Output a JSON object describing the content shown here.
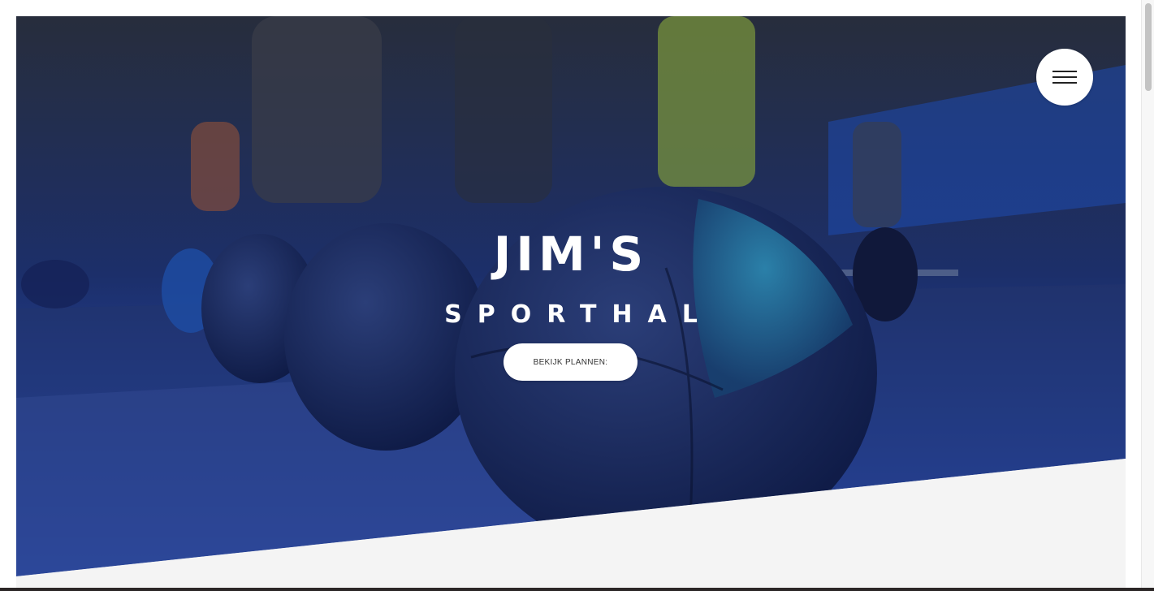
{
  "hero": {
    "title": "JIM'S",
    "subtitle": "SPORTHAL",
    "cta_label": "BEKIJK PLANNEN:",
    "image_subject": "gym with medicine balls on floor and people exercising",
    "overlay_color": "#0a2a7a"
  },
  "menu": {
    "icon": "hamburger-menu-icon"
  },
  "colors": {
    "overlay_top": "#1a2550",
    "overlay_bottom": "#2f57c9",
    "section_background": "#f4f4f4",
    "button_background": "#ffffff"
  }
}
